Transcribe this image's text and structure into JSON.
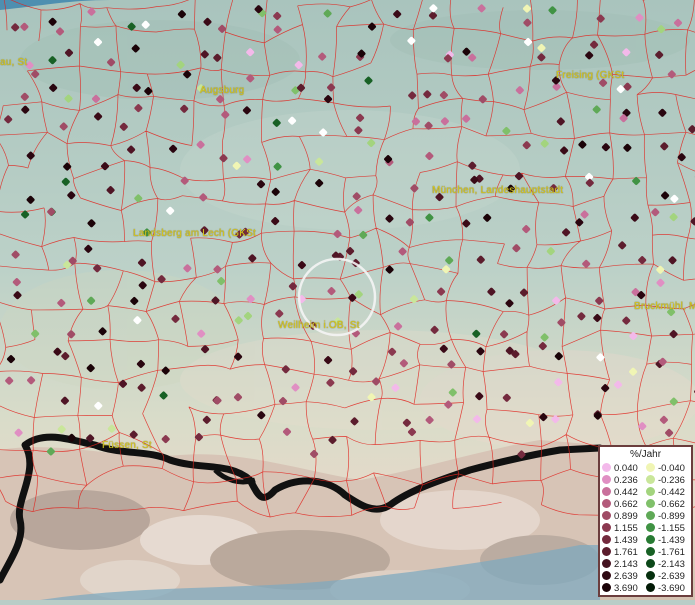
{
  "map": {
    "places": [
      {
        "name": "Augsburg"
      },
      {
        "name": "Freising (GKSt"
      },
      {
        "name": "München, Landeshauptstadt"
      },
      {
        "name": "Landsberg am Lech (GKSt"
      },
      {
        "name": "Weilheim i.OB, St"
      },
      {
        "name": "Füssen, St"
      },
      {
        "name": "Bruckmühl, M"
      },
      {
        "name": "au, St"
      }
    ]
  },
  "legend": {
    "title": "%/Jahr",
    "positive": [
      {
        "label": "0.040",
        "color": "#f3b9ea"
      },
      {
        "label": "0.236",
        "color": "#e08fc3"
      },
      {
        "label": "0.442",
        "color": "#c9709c"
      },
      {
        "label": "0.662",
        "color": "#b35a7b"
      },
      {
        "label": "0.899",
        "color": "#a04c66"
      },
      {
        "label": "1.155",
        "color": "#8b3950"
      },
      {
        "label": "1.439",
        "color": "#742a3e"
      },
      {
        "label": "1.761",
        "color": "#5c1d2d"
      },
      {
        "label": "2.143",
        "color": "#451320"
      },
      {
        "label": "2.639",
        "color": "#300a14"
      },
      {
        "label": "3.690",
        "color": "#1b0308"
      }
    ],
    "negative": [
      {
        "label": "-0.040",
        "color": "#f0f5b4"
      },
      {
        "label": "-0.236",
        "color": "#c9e69a"
      },
      {
        "label": "-0.442",
        "color": "#a3d47e"
      },
      {
        "label": "-0.662",
        "color": "#80c06a"
      },
      {
        "label": "-0.899",
        "color": "#5fa957"
      },
      {
        "label": "-1.155",
        "color": "#409344"
      },
      {
        "label": "-1.439",
        "color": "#287b33"
      },
      {
        "label": "-1.761",
        "color": "#186125"
      },
      {
        "label": "-2.143",
        "color": "#0c4819"
      },
      {
        "label": "-2.639",
        "color": "#06300f"
      },
      {
        "label": "-3.690",
        "color": "#021a06"
      }
    ]
  }
}
